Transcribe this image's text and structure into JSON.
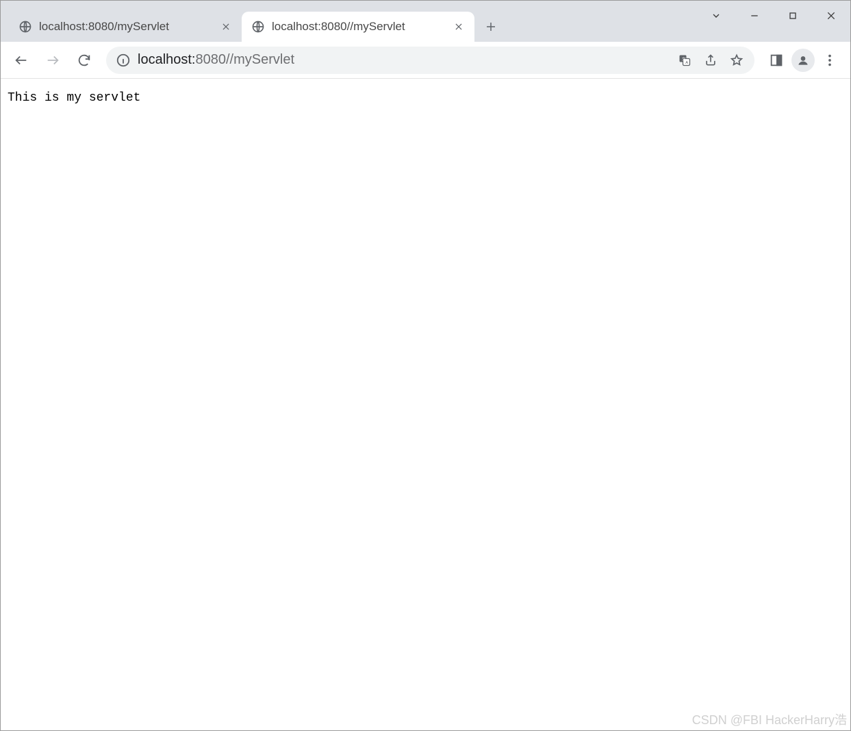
{
  "tabs": [
    {
      "title": "localhost:8080/myServlet",
      "active": false
    },
    {
      "title": "localhost:8080//myServlet",
      "active": true
    }
  ],
  "address": {
    "host": "localhost:",
    "port_path": "8080//myServlet"
  },
  "page": {
    "body_text": "This is my servlet"
  },
  "watermark": "CSDN @FBI HackerHarry浩"
}
